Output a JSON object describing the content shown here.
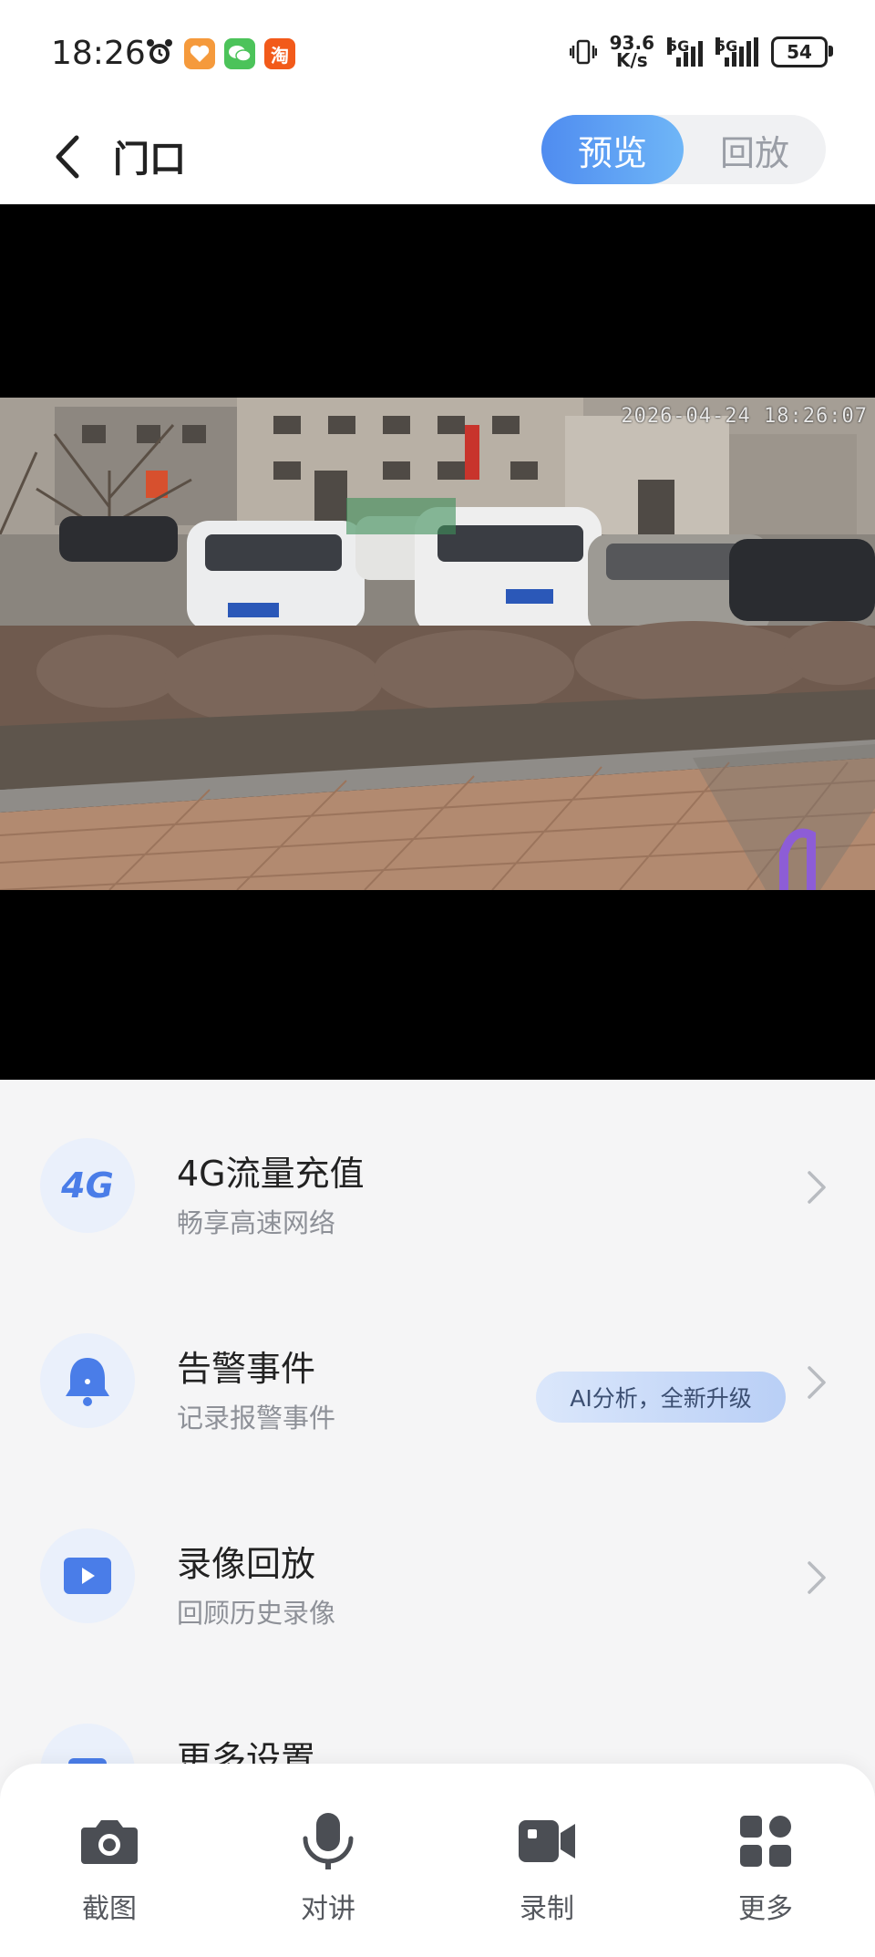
{
  "status_bar": {
    "time": "18:26",
    "net_speed_value": "93.6",
    "net_speed_unit": "K/s",
    "sim1_label": "5G",
    "sim2_label": "5G",
    "battery": "54",
    "taobao_glyph": "淘"
  },
  "header": {
    "title": "门口",
    "tabs": [
      {
        "label": "预览",
        "active": true
      },
      {
        "label": "回放",
        "active": false
      }
    ]
  },
  "video": {
    "timestamp": "2026-04-24 18:26:07"
  },
  "menu": {
    "items": [
      {
        "icon": "4g-icon",
        "icon_text": "4G",
        "title": "4G流量充值",
        "subtitle": "畅享高速网络"
      },
      {
        "icon": "bell-icon",
        "title": "告警事件",
        "subtitle": "记录报警事件",
        "badge": "AI分析，全新升级"
      },
      {
        "icon": "play-icon",
        "title": "录像回放",
        "subtitle": "回顾历史录像"
      },
      {
        "icon": "settings-icon",
        "title": "更多设置"
      }
    ]
  },
  "bottom_bar": {
    "items": [
      {
        "label": "截图",
        "icon": "camera-icon"
      },
      {
        "label": "对讲",
        "icon": "microphone-icon"
      },
      {
        "label": "录制",
        "icon": "video-record-icon"
      },
      {
        "label": "更多",
        "icon": "grid-icon"
      }
    ]
  },
  "colors": {
    "accent": "#4f8cf0",
    "icon_blue": "#4a7de8",
    "icon_bg": "#eaf0fb"
  }
}
